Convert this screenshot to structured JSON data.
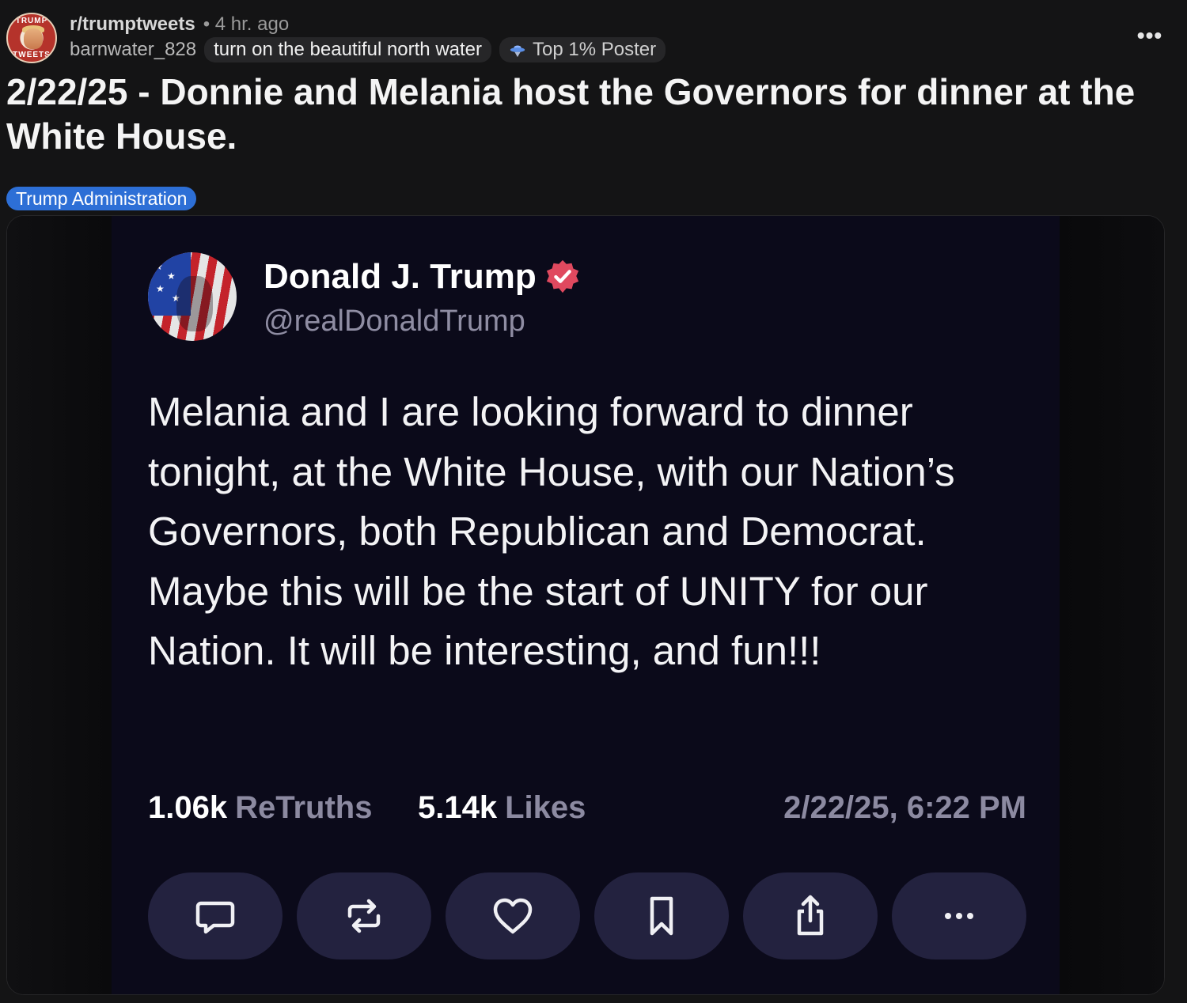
{
  "post": {
    "subreddit": "r/trumptweets",
    "time": "• 4 hr. ago",
    "username": "barnwater_828",
    "user_flair": "turn on the beautiful north water",
    "achievement_badge": "Top 1% Poster",
    "title": "2/22/25 - Donnie and Melania host the Governors for dinner at the White House.",
    "post_flair": "Trump Administration",
    "subreddit_icon_text_top": "TRUMP",
    "subreddit_icon_text_bottom": "TWEETS",
    "more_icon": "ellipsis-icon",
    "colors": {
      "background": "#141415",
      "flair_blue": "#2d6fd6",
      "truth_card": "#0b0a1a",
      "action_pill": "#23223f",
      "verified": "#e0495f"
    }
  },
  "truth": {
    "display_name": "Donald J. Trump",
    "handle": "@realDonaldTrump",
    "body": "Melania and I are looking forward to dinner tonight, at the White House, with our Nation’s Governors, both Republican and Democrat. Maybe this will be the start of UNITY for our Nation. It will be interesting, and fun!!!",
    "retruths_count": "1.06k",
    "retruths_label": "ReTruths",
    "likes_count": "5.14k",
    "likes_label": "Likes",
    "timestamp": "2/22/25, 6:22 PM",
    "actions": [
      "reply-icon",
      "retruth-icon",
      "like-heart-icon",
      "bookmark-icon",
      "share-icon",
      "more-ellipsis-icon"
    ]
  }
}
